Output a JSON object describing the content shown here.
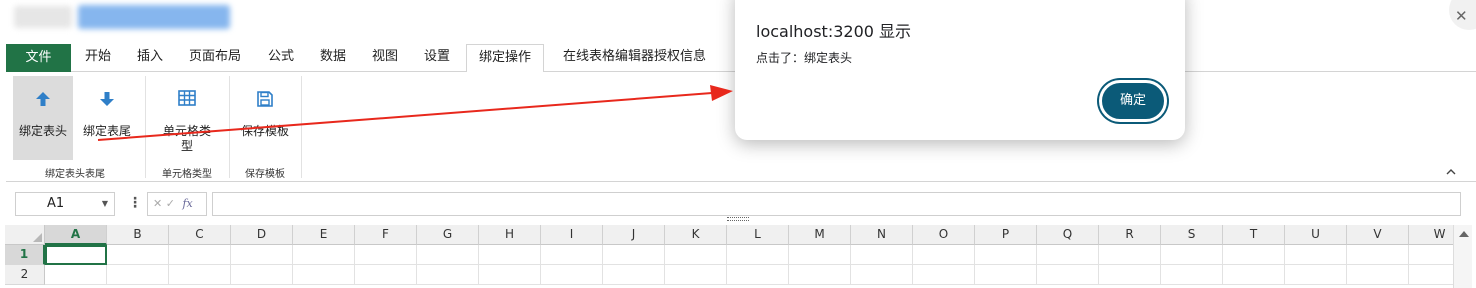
{
  "ribbon_tabs": [
    "文件",
    "开始",
    "插入",
    "页面布局",
    "公式",
    "数据",
    "视图",
    "设置",
    "绑定操作",
    "在线表格编辑器授权信息"
  ],
  "ribbon": {
    "bind_header": "绑定表头",
    "bind_footer": "绑定表尾",
    "cell_type_line1": "单元格类",
    "cell_type_line2": "型",
    "save_template": "保存模板",
    "group1_label": "绑定表头表尾",
    "group2_label": "单元格类型",
    "group3_label": "保存模板"
  },
  "formula_bar": {
    "name_box": "A1",
    "fx": "fx",
    "cancel_mark": "✕",
    "confirm_mark": "✓",
    "formula": ""
  },
  "grid": {
    "columns": [
      "A",
      "B",
      "C",
      "D",
      "E",
      "F",
      "G",
      "H",
      "I",
      "J",
      "K",
      "L",
      "M",
      "N",
      "O",
      "P",
      "Q",
      "R",
      "S",
      "T",
      "U",
      "V",
      "W"
    ],
    "rows": [
      "1",
      "2"
    ],
    "active_cell": "A1"
  },
  "dialog": {
    "title": "localhost:3200 显示",
    "message": "点击了：绑定表头",
    "ok_label": "确定"
  },
  "colors": {
    "file_tab": "#217346",
    "dialog_button": "#0b5a78",
    "ribbon_icon": "#2f7fc8",
    "annotation_arrow": "#e8281c"
  },
  "icons": {
    "bind_header": "arrow-up-icon",
    "bind_footer": "arrow-down-icon",
    "cell_type": "table-icon",
    "save": "save-icon",
    "collapse": "chevron-up-icon"
  }
}
